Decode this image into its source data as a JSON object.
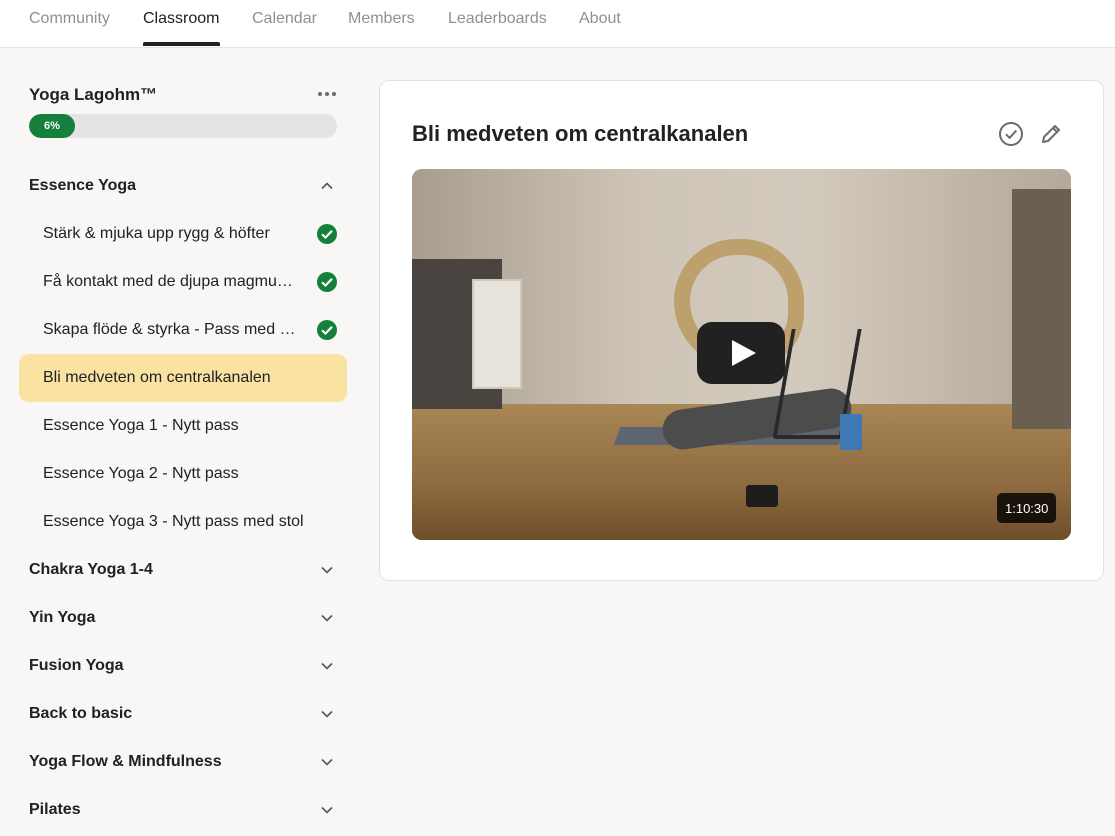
{
  "nav": {
    "tabs": [
      "Community",
      "Classroom",
      "Calendar",
      "Members",
      "Leaderboards",
      "About"
    ],
    "active_tab": "Classroom"
  },
  "course": {
    "title": "Yoga Lagohm™",
    "progress_label": "6%",
    "progress_value": 6
  },
  "sidebar": {
    "sections": [
      {
        "title": "Essence Yoga",
        "expanded": true,
        "lessons": [
          {
            "label": "Stärk & mjuka upp rygg & höfter",
            "completed": true
          },
          {
            "label": "Få kontakt med de djupa magmusklerna",
            "completed": true
          },
          {
            "label": "Skapa flöde & styrka - Pass med stol",
            "completed": true
          },
          {
            "label": "Bli medveten om centralkanalen",
            "completed": false,
            "active": true
          },
          {
            "label": "Essence Yoga 1 - Nytt pass",
            "completed": false
          },
          {
            "label": "Essence Yoga 2 - Nytt pass",
            "completed": false
          },
          {
            "label": "Essence Yoga 3 - Nytt pass med stol",
            "completed": false
          }
        ]
      },
      {
        "title": "Chakra Yoga 1-4",
        "expanded": false
      },
      {
        "title": "Yin Yoga",
        "expanded": false
      },
      {
        "title": "Fusion Yoga",
        "expanded": false
      },
      {
        "title": "Back to basic",
        "expanded": false
      },
      {
        "title": "Yoga Flow & Mindfulness",
        "expanded": false
      },
      {
        "title": "Pilates",
        "expanded": false
      }
    ]
  },
  "lesson": {
    "title": "Bli medveten om centralkanalen",
    "video_duration": "1:10:30"
  },
  "colors": {
    "accent_green": "#14803c",
    "active_lesson_bg": "#fae2a1",
    "page_bg": "#f8f7f5"
  },
  "icons": {
    "more": "more-horizontal-icon",
    "expand": "chevron-down-icon",
    "collapse": "chevron-up-icon",
    "complete": "check-circle-icon",
    "mark_done": "check-circle-outline-icon",
    "edit": "pencil-icon",
    "play": "play-icon"
  }
}
